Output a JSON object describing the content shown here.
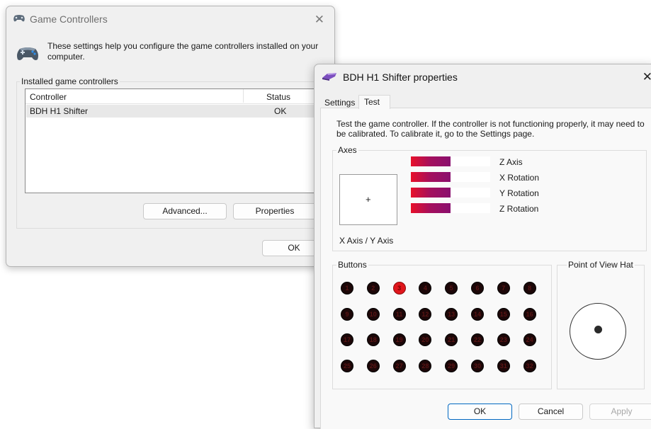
{
  "game_controllers": {
    "title": "Game Controllers",
    "close_glyph": "✕",
    "description": "These settings help you configure the game controllers installed on your computer.",
    "group_label": "Installed game controllers",
    "columns": {
      "controller": "Controller",
      "status": "Status"
    },
    "rows": [
      {
        "controller": "BDH H1 Shifter",
        "status": "OK"
      }
    ],
    "buttons": {
      "advanced": "Advanced...",
      "properties": "Properties",
      "ok": "OK"
    },
    "icon": "gamepad-icon"
  },
  "properties": {
    "title": "BDH H1 Shifter properties",
    "close_glyph": "✕",
    "icon": "steering-wheel-icon",
    "tabs": [
      "Settings",
      "Test"
    ],
    "active_tab": "Test",
    "instructions": "Test the game controller.  If the controller is not functioning properly, it may need to be calibrated.  To calibrate it, go to the Settings page.",
    "axes": {
      "label": "Axes",
      "xy_label": "X Axis / Y Axis",
      "crosshair_glyph": "+",
      "bars": [
        {
          "label": "Z Axis",
          "level": 0.5
        },
        {
          "label": "X Rotation",
          "level": 0.5
        },
        {
          "label": "Y Rotation",
          "level": 0.5
        },
        {
          "label": "Z Rotation",
          "level": 0.5
        }
      ],
      "bar_colors": [
        "#e8102a",
        "#8a0f6e"
      ]
    },
    "buttons_group": {
      "label": "Buttons",
      "items": [
        {
          "n": "1",
          "on": false
        },
        {
          "n": "2",
          "on": false
        },
        {
          "n": "3",
          "on": true
        },
        {
          "n": "4",
          "on": false
        },
        {
          "n": "5",
          "on": false
        },
        {
          "n": "6",
          "on": false
        },
        {
          "n": "7",
          "on": false
        },
        {
          "n": "8",
          "on": false
        },
        {
          "n": "9",
          "on": false
        },
        {
          "n": "10",
          "on": false
        },
        {
          "n": "11",
          "on": false
        },
        {
          "n": "12",
          "on": false
        },
        {
          "n": "13",
          "on": false
        },
        {
          "n": "14",
          "on": false
        },
        {
          "n": "15",
          "on": false
        },
        {
          "n": "16",
          "on": false
        },
        {
          "n": "17",
          "on": false
        },
        {
          "n": "18",
          "on": false
        },
        {
          "n": "19",
          "on": false
        },
        {
          "n": "20",
          "on": false
        },
        {
          "n": "21",
          "on": false
        },
        {
          "n": "22",
          "on": false
        },
        {
          "n": "23",
          "on": false
        },
        {
          "n": "24",
          "on": false
        },
        {
          "n": "25",
          "on": false
        },
        {
          "n": "26",
          "on": false
        },
        {
          "n": "27",
          "on": false
        },
        {
          "n": "28",
          "on": false
        },
        {
          "n": "29",
          "on": false
        },
        {
          "n": "30",
          "on": false
        },
        {
          "n": "31",
          "on": false
        },
        {
          "n": "32",
          "on": false
        }
      ],
      "on_color": "#e0161c",
      "off_color": "#1c0708"
    },
    "pov": {
      "label": "Point of View Hat"
    },
    "footer": {
      "ok": "OK",
      "cancel": "Cancel",
      "apply": "Apply"
    }
  }
}
